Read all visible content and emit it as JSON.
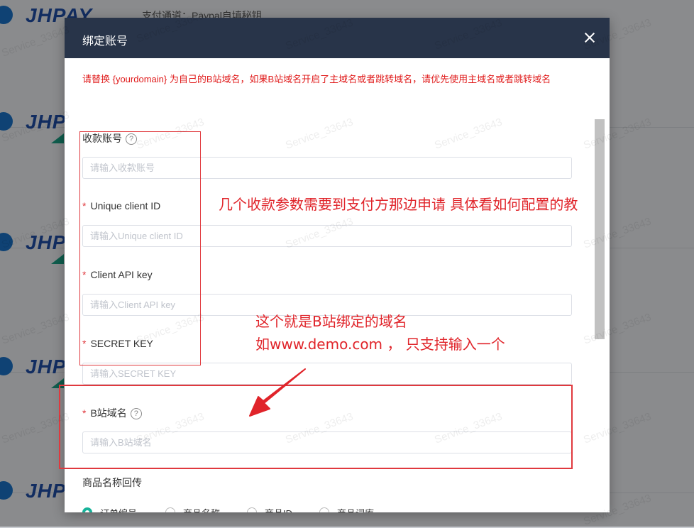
{
  "background": {
    "logo_text": "JHPAY",
    "top_text": "支付通道：Paypal自填秘钥"
  },
  "watermark_text": "Service_33643",
  "modal": {
    "title": "绑定账号",
    "notice": "请替换 {yourdomain} 为自己的B站域名，如果B站域名开启了主域名或者跳转域名，请优先使用主域名或者跳转域名",
    "fields": [
      {
        "label": "收款账号",
        "required": false,
        "help": true,
        "placeholder": "请输入收款账号",
        "value": ""
      },
      {
        "label": "Unique client ID",
        "required": true,
        "help": false,
        "placeholder": "请输入Unique client ID",
        "value": ""
      },
      {
        "label": "Client API key",
        "required": true,
        "help": false,
        "placeholder": "请输入Client API key",
        "value": ""
      },
      {
        "label": "SECRET KEY",
        "required": true,
        "help": false,
        "placeholder": "请输入SECRET KEY",
        "value": ""
      },
      {
        "label": "B站域名",
        "required": true,
        "help": true,
        "placeholder": "请输入B站域名",
        "value": ""
      }
    ],
    "product_name_label": "商品名称回传",
    "radio_options": [
      {
        "label": "订单编号",
        "checked": true
      },
      {
        "label": "商品名称",
        "checked": false
      },
      {
        "label": "商品ID",
        "checked": false
      },
      {
        "label": "商品词库",
        "checked": false
      }
    ],
    "required_mark": "*",
    "help_mark": "?"
  },
  "annotations": {
    "params_note": "几个收款参数需要到支付方那边申请 具体看如何配置的教",
    "domain_note_line1": "这个就是B站绑定的域名",
    "domain_note_line2": "如www.demo.com ， 只支持输入一个"
  },
  "colors": {
    "header": "#283449",
    "notice_red": "#e01b1b",
    "annotation_red": "#e0393e",
    "accent_green": "#17b39a"
  }
}
